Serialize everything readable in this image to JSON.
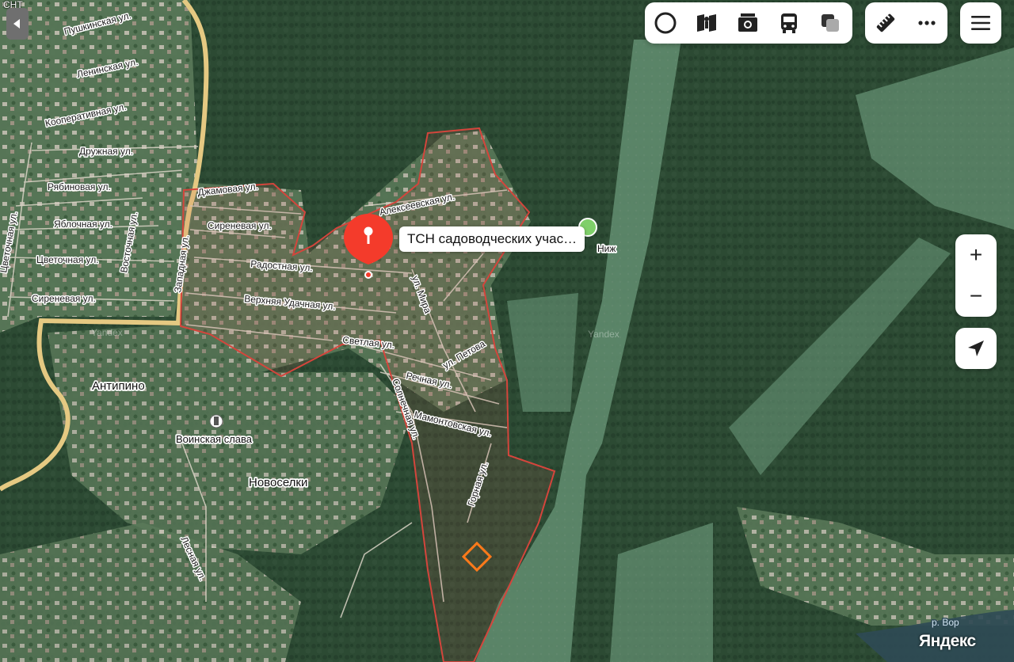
{
  "map": {
    "corner_text": "СНТ",
    "watermark": "Yandex",
    "logo": "Яндекс",
    "river_label": "р. Вор",
    "streets": [
      "Пушкинская ул.",
      "Ленинская ул.",
      "Кооперативная ул.",
      "Дружная ул.",
      "Рябиновая ул.",
      "Яблочная ул.",
      "Цветочная ул.",
      "Сиреневая ул.",
      "Джамовая ул.",
      "Сиреневая ул.",
      "Радостная ул.",
      "Верхняя Удачная ул.",
      "Алексеевская ул.",
      "ул. Мира",
      "Светлая ул.",
      "Речная ул.",
      "ул. Петова",
      "Мамонтовская ул.",
      "Горная ул.",
      "Солнечная ул.",
      "Западная ул.",
      "Цветочная ул.",
      "Восточная ул.",
      "Лесная ул."
    ],
    "places": [
      "Антипино",
      "Воинская слава",
      "Новоселки"
    ],
    "pin": {
      "label": "ТСН садоводческих учас…",
      "color": "#f43b2b"
    },
    "poi_partial_label": "Ниж"
  },
  "toolbar": {
    "group1": [
      {
        "name": "layers-icon"
      },
      {
        "name": "panorama-icon"
      },
      {
        "name": "photo-icon"
      },
      {
        "name": "transit-icon"
      },
      {
        "name": "traffic-icon"
      }
    ],
    "group2": [
      {
        "name": "ruler-icon"
      },
      {
        "name": "more-icon"
      }
    ],
    "menu": {
      "name": "menu-icon"
    }
  },
  "zoom": {
    "in": "+",
    "out": "−"
  },
  "colors": {
    "boundary": "#d4453c",
    "main_road": "#e5c982",
    "accent_orange": "#ff7a1a"
  }
}
